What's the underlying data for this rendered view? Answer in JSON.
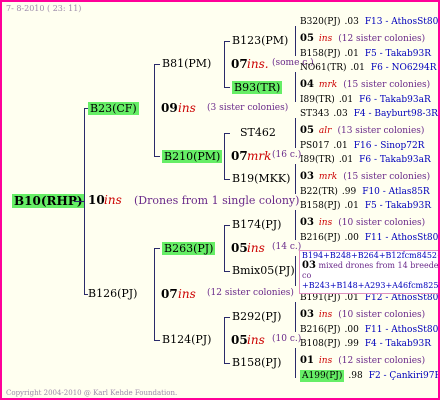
{
  "header": {
    "date": "7-  8-2010 ( 23: 11)"
  },
  "footer": {
    "copyright": "Copyright 2004-2010 @ Karl Kehde Foundation."
  },
  "root": {
    "label": "B10(RHP)",
    "num": "10",
    "ins": "ins",
    "desc": "(Drones from 1 single colony)"
  },
  "g1": {
    "b23": {
      "label": "B23(CF)",
      "num": "09",
      "ins": "ins",
      "desc": "(3 sister colonies)"
    },
    "b126": {
      "label": "B126(PJ)",
      "num": "07",
      "ins": "ins",
      "desc": "(12 sister colonies)"
    }
  },
  "g2": {
    "b81": {
      "label": "B81(PM)",
      "num": "07",
      "ins": "ins.",
      "desc": "(some c.)"
    },
    "b210": {
      "label": "B210(PM)",
      "num": "07",
      "ins": "mrk",
      "desc": "(16 c.)"
    },
    "b263": {
      "label": "B263(PJ)",
      "num": "05",
      "ins": "ins",
      "desc": "(14 c.)"
    },
    "b124": {
      "label": "B124(PJ)",
      "num": "05",
      "ins": "ins",
      "desc": "(10 c.)"
    }
  },
  "g3": {
    "b123": "B123(PM)",
    "b93": "B93(TR)",
    "st462": "ST462",
    "b19": "B19(MKK)",
    "b174": "B174(PJ)",
    "bmix": "Bmix05(PJ)",
    "b292": "B292(PJ)",
    "b158": "B158(PJ)"
  },
  "g4": [
    {
      "name": "B320(PJ)",
      "year": ".03",
      "line": "F13 - AthosSt80R"
    },
    {
      "num": "05",
      "ins": "ins",
      "desc": "(12 sister colonies)"
    },
    {
      "name": "B158(PJ)",
      "year": ".01",
      "line": "F5 - Takab93R"
    },
    {
      "name": "NO61(TR)",
      "year": ".01",
      "line": "F6 - NO6294R"
    },
    {
      "num": "04",
      "ins": "mrk",
      "desc": "(15 sister colonies)"
    },
    {
      "name": "I89(TR)",
      "year": ".01",
      "line": "F6 - Takab93aR"
    },
    {
      "name": "ST343",
      "year": ".03",
      "line": "F4 - Bayburt98-3R"
    },
    {
      "num": "05",
      "ins": "alr",
      "desc": "(13 sister colonies)"
    },
    {
      "name": "PS017",
      "year": ".01",
      "line": "F16 - Sinop72R"
    },
    {
      "name": "I89(TR)",
      "year": ".01",
      "line": "F6 - Takab93aR"
    },
    {
      "num": "03",
      "ins": "mrk",
      "desc": "(15 sister colonies)"
    },
    {
      "name": "B22(TR)",
      "year": ".99",
      "line": "F10 - Atlas85R"
    },
    {
      "name": "B158(PJ)",
      "year": ".01",
      "line": "F5 - Takab93R"
    },
    {
      "num": "03",
      "ins": "ins",
      "desc": "(10 sister colonies)"
    },
    {
      "name": "B216(PJ)",
      "year": ".00",
      "line": "F11 - AthosSt80R"
    },
    {
      "name": "B191(PJ)",
      "year": ".01",
      "line": "F12 - AthosSt80R"
    },
    {
      "num": "03",
      "ins": "ins",
      "desc": "(10 sister colonies)"
    },
    {
      "name": "B216(PJ)",
      "year": ".00",
      "line": "F11 - AthosSt80R"
    },
    {
      "name": "B108(PJ)",
      "year": ".99",
      "line": "F4 - Takab93R"
    },
    {
      "num": "01",
      "ins": "ins",
      "desc": "(12 sister colonies)"
    },
    {
      "name": "A199(PJ)",
      "year": ".98",
      "line": "F2 - Çankiri97R"
    }
  ],
  "mix": {
    "top": "B194+B248+B264+B12fcm8452+B2",
    "num": "03",
    "mid": "mixed drones from 14 breeder co",
    "bot": "+B243+B148+A293+A46fcm8255"
  }
}
